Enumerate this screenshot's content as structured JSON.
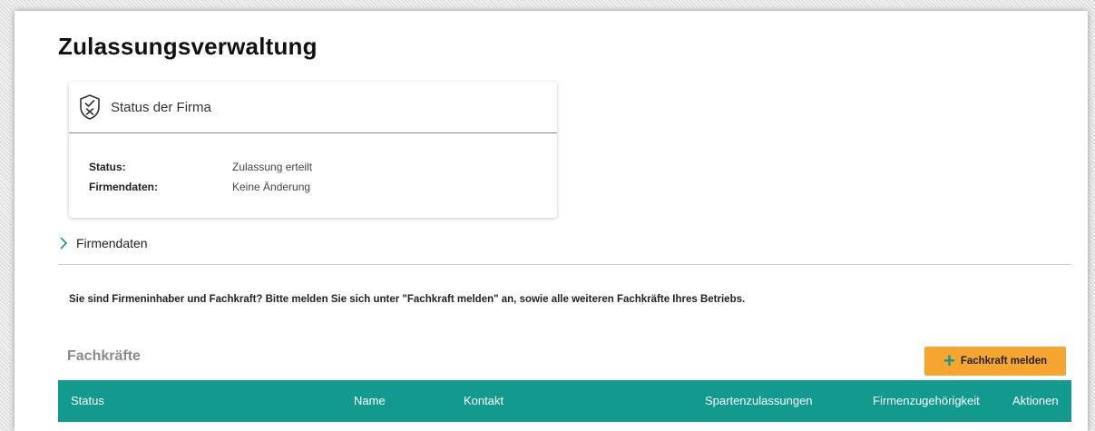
{
  "page": {
    "title": "Zulassungsverwaltung"
  },
  "status_card": {
    "header": "Status der Firma",
    "rows": [
      {
        "label": "Status:",
        "value": "Zulassung erteilt"
      },
      {
        "label": "Firmendaten:",
        "value": "Keine Änderung"
      }
    ]
  },
  "firmendaten_toggle": {
    "label": "Firmendaten"
  },
  "notice": "Sie sind Firmeninhaber und Fachkraft? Bitte melden Sie sich unter \"Fachkraft melden\" an, sowie alle weiteren Fachkräfte Ihres Betriebs.",
  "fachkraefte": {
    "title": "Fachkräfte",
    "add_button": "Fachkraft melden",
    "columns": [
      "Status",
      "Name",
      "Kontakt",
      "Spartenzulassungen",
      "Firmenzugehörigkeit",
      "Aktionen"
    ]
  },
  "colors": {
    "accent_teal": "#129a8e",
    "button_orange": "#f6a531"
  },
  "icons": {
    "status_header": "shield-check-cross-icon",
    "expand": "chevron-right-icon",
    "add": "plus-icon"
  }
}
